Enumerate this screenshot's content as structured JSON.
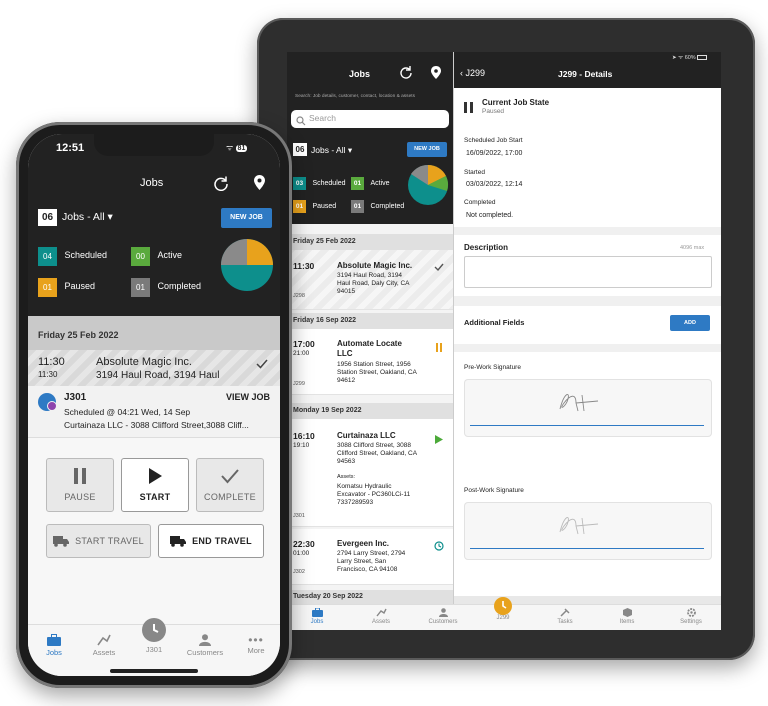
{
  "tablet": {
    "status": {
      "battery": "60%"
    },
    "jobs_header": {
      "title": "Jobs"
    },
    "search": {
      "hint": "Search: Job details, customer, contact, location & assets",
      "placeholder": "Search"
    },
    "filter": {
      "count": "06",
      "label": "Jobs - All ▾",
      "new_job": "NEW JOB"
    },
    "stats": [
      {
        "count": "03",
        "label": "Scheduled",
        "color": "#0d8f8c"
      },
      {
        "count": "01",
        "label": "Active",
        "color": "#5aaa3d"
      },
      {
        "count": "01",
        "label": "Paused",
        "color": "#e8a21c"
      },
      {
        "count": "01",
        "label": "Completed",
        "color": "#7a7a7a"
      }
    ],
    "groups": [
      {
        "date": "Friday  25 Feb 2022"
      },
      {
        "date": "Friday  16 Sep 2022"
      },
      {
        "date": "Monday  19 Sep 2022"
      },
      {
        "date": "Tuesday  20 Sep 2022"
      }
    ],
    "jobs": [
      {
        "start": "11:30",
        "end": "",
        "id": "J298",
        "customer": "Absolute Magic Inc.",
        "address": "3194 Haul Road, 3194 Haul Road, Daly City, CA 94015",
        "status_icon": "check-icon",
        "assets_label": "",
        "assets": ""
      },
      {
        "start": "17:00",
        "end": "21:00",
        "id": "J299",
        "customer": "Automate Locate LLC",
        "address": "1956 Station Street, 1956 Station Street, Oakland, CA 94612",
        "status_icon": "pause-icon",
        "assets_label": "",
        "assets": ""
      },
      {
        "start": "16:10",
        "end": "19:10",
        "id": "J301",
        "customer": "Curtainaza LLC",
        "address": "3088 Clifford Street, 3088 Clifford Street, Oakland, CA 94563",
        "status_icon": "play-icon",
        "assets_label": "Assets:",
        "assets": "Komatsu Hydraulic Excavator - PC360LCi-11 7337289593"
      },
      {
        "start": "22:30",
        "end": "01:00",
        "id": "J302",
        "customer": "Evergeen Inc.",
        "address": "2794 Larry Street, 2794 Larry Street, San Francisco, CA 94108",
        "status_icon": "clock-icon",
        "assets_label": "",
        "assets": ""
      }
    ],
    "details": {
      "back_label": "J299",
      "title": "J299 - Details",
      "state_label": "Current Job State",
      "state_value": "Paused",
      "scheduled_label": "Scheduled Job Start",
      "scheduled_value": "16/09/2022, 17:00",
      "started_label": "Started",
      "started_value": "03/03/2022, 12:14",
      "completed_label": "Completed",
      "completed_value": "Not completed.",
      "description_label": "Description",
      "description_max": "4096 max",
      "additional_label": "Additional Fields",
      "add_button": "ADD",
      "pre_signature": "Pre-Work Signature",
      "post_signature": "Post-Work Signature"
    },
    "tabs": [
      "Jobs",
      "Assets",
      "Customers",
      "J299",
      "Tasks",
      "Items",
      "Settings"
    ]
  },
  "phone": {
    "time": "12:51",
    "battery": "81",
    "header_title": "Jobs",
    "filter": {
      "count": "06",
      "label": "Jobs - All ▾",
      "new_job": "NEW JOB"
    },
    "stats": [
      {
        "count": "04",
        "label": "Scheduled",
        "color": "#0d8f8c"
      },
      {
        "count": "00",
        "label": "Active",
        "color": "#5aaa3d"
      },
      {
        "count": "01",
        "label": "Paused",
        "color": "#e8a21c"
      },
      {
        "count": "01",
        "label": "Completed",
        "color": "#7a7a7a"
      }
    ],
    "date_strip": "Friday  25 Feb 2022",
    "job_preview": {
      "start": "11:30",
      "end": "11:30",
      "customer": "Absolute Magic Inc.",
      "address": "3194 Haul Road, 3194 Haul"
    },
    "active_card": {
      "id": "J301",
      "view_label": "VIEW JOB",
      "schedule": "Scheduled @ 04:21 Wed, 14 Sep",
      "address": "Curtainaza LLC - 3088 Clifford Street,3088 Cliff..."
    },
    "actions": {
      "pause": "PAUSE",
      "start": "START",
      "complete": "COMPLETE",
      "start_travel": "START TRAVEL",
      "end_travel": "END TRAVEL"
    },
    "tabs": [
      "Jobs",
      "Assets",
      "J301",
      "Customers",
      "More"
    ]
  }
}
